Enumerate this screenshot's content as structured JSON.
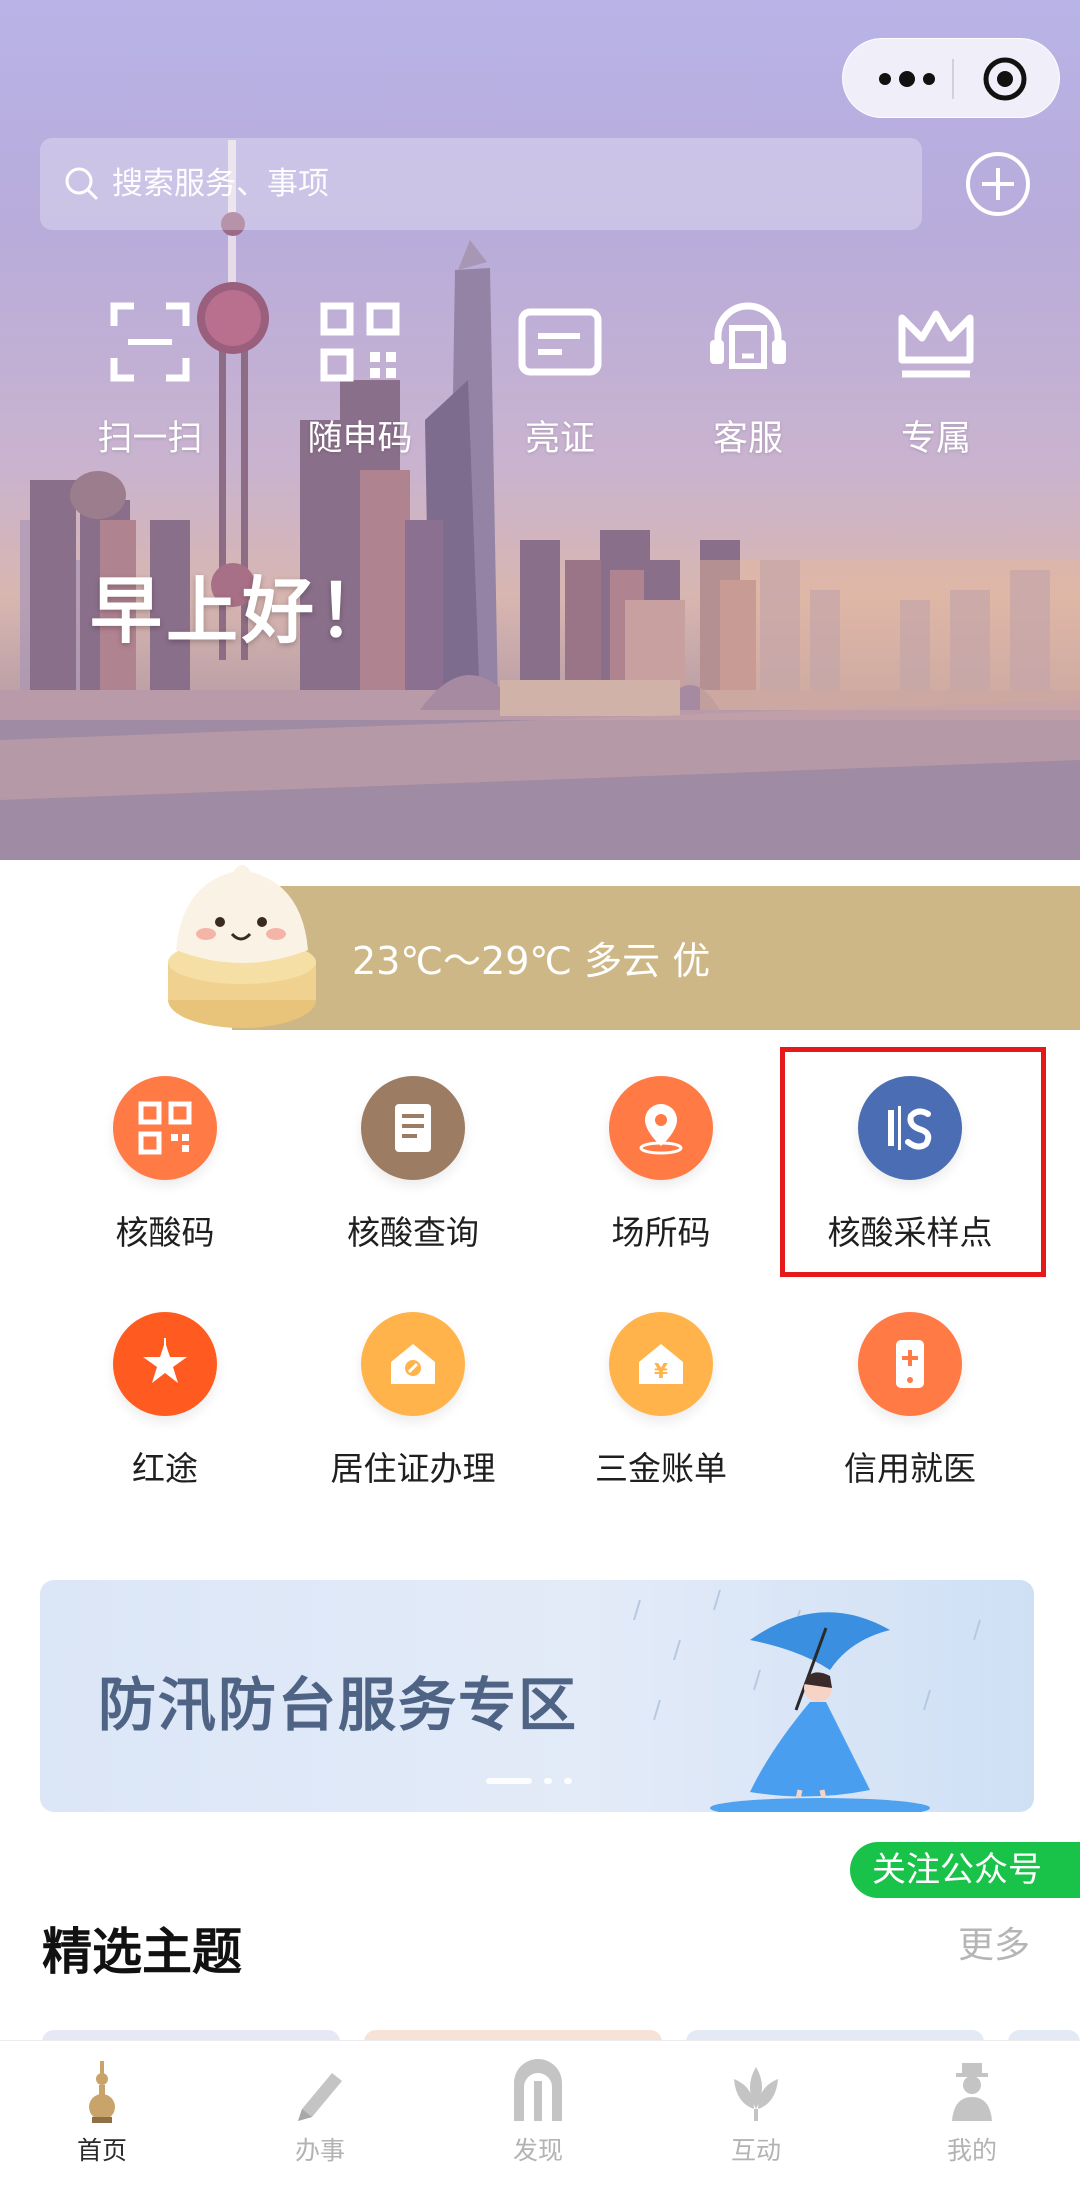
{
  "top_capsule": {
    "more_icon": "more-dots-icon",
    "close_icon": "miniapp-close-icon"
  },
  "search": {
    "placeholder": "搜索服务、事项",
    "add_icon": "plus-circle-icon"
  },
  "quick_actions": [
    {
      "label": "扫一扫",
      "icon": "scan-icon"
    },
    {
      "label": "随申码",
      "icon": "qrcode-icon"
    },
    {
      "label": "亮证",
      "icon": "id-card-icon"
    },
    {
      "label": "客服",
      "icon": "headset-icon"
    },
    {
      "label": "专属",
      "icon": "crown-icon"
    }
  ],
  "greeting": "早上好！",
  "weather": {
    "text": "23℃～29℃ 多云 优"
  },
  "services": [
    {
      "label": "核酸码",
      "icon": "qrcode-icon",
      "color": "#ff7a45"
    },
    {
      "label": "核酸查询",
      "icon": "document-icon",
      "color": "#9c7c63"
    },
    {
      "label": "场所码",
      "icon": "location-pin-icon",
      "color": "#ff7a45"
    },
    {
      "label": "核酸采样点",
      "icon": "sampling-site-logo-icon",
      "color": "#4a6db3"
    },
    {
      "label": "红途",
      "icon": "star-flag-icon",
      "color": "#ff5a1f"
    },
    {
      "label": "居住证办理",
      "icon": "house-icon",
      "color": "#ffb34a"
    },
    {
      "label": "三金账单",
      "icon": "yuan-house-icon",
      "color": "#ffb34a"
    },
    {
      "label": "信用就医",
      "icon": "phone-medical-icon",
      "color": "#ff7a45"
    }
  ],
  "banner": {
    "title": "防汛防台服务专区"
  },
  "follow_button": "关注公众号",
  "featured": {
    "title": "精选主题",
    "more": "更多"
  },
  "tabs": [
    {
      "label": "首页",
      "icon": "tower-icon",
      "active": true
    },
    {
      "label": "办事",
      "icon": "pen-icon",
      "active": false
    },
    {
      "label": "发现",
      "icon": "arch-icon",
      "active": false
    },
    {
      "label": "互动",
      "icon": "magnolia-icon",
      "active": false
    },
    {
      "label": "我的",
      "icon": "person-icon",
      "active": false
    }
  ],
  "colors": {
    "accent_gold": "#cdb787",
    "highlight_red": "#e5191a",
    "follow_green": "#19c248"
  }
}
